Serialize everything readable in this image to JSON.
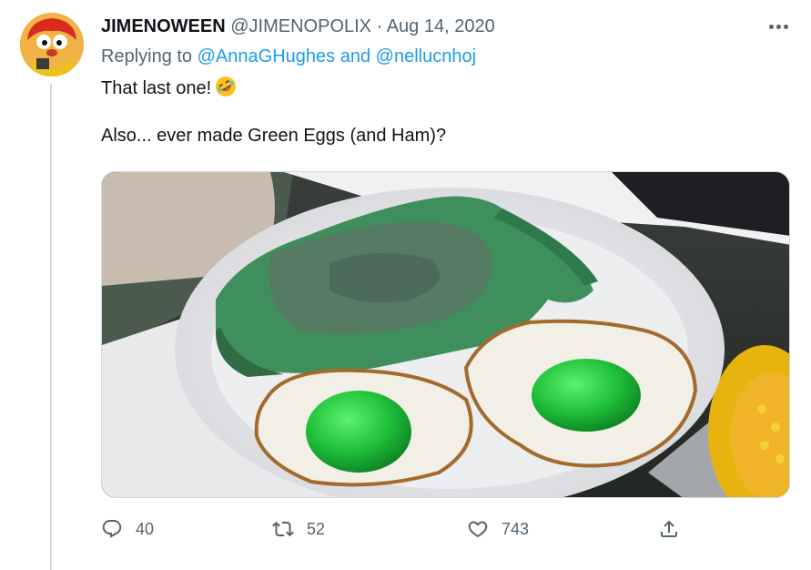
{
  "tweet": {
    "display_name": "JIMENOWEEN",
    "handle": "@JIMENOPOLIX",
    "separator": "·",
    "date": "Aug 14, 2020",
    "replying_prefix": "Replying to",
    "reply_to_1": "@AnnaGHughes",
    "reply_and": "and",
    "reply_to_2": "@nellucnhoj",
    "line1": "That last one!",
    "line2": "Also... ever made Green Eggs (and Ham)?",
    "emoji": "rolling-on-floor-laughing-emoji"
  },
  "actions": {
    "replies": "40",
    "retweets": "52",
    "likes": "743"
  },
  "colors": {
    "link": "#1d9bf0",
    "muted": "#536471",
    "text": "#0f1419",
    "egg_green": "#1fc13a",
    "ham_green": "#3f8f5c"
  }
}
